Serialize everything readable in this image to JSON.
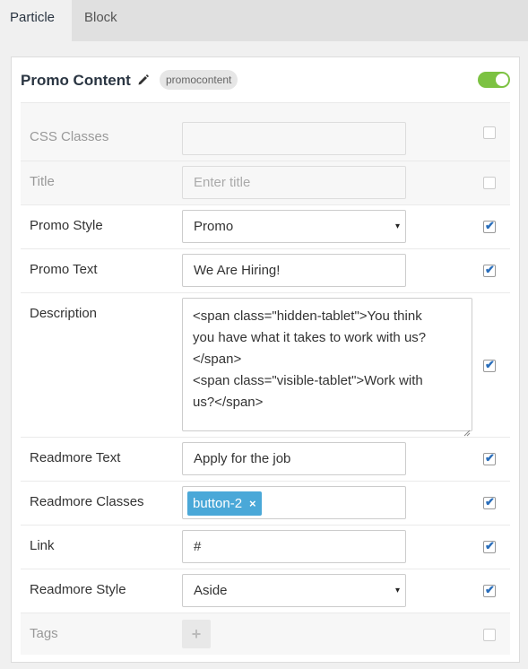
{
  "tabs": [
    {
      "label": "Particle",
      "active": true
    },
    {
      "label": "Block",
      "active": false
    }
  ],
  "card": {
    "title": "Promo Content",
    "badge": "promocontent",
    "enabled": true
  },
  "rows": {
    "css_classes": {
      "label": "CSS Classes",
      "value": "",
      "checked": false
    },
    "title": {
      "label": "Title",
      "placeholder": "Enter title",
      "checked": false
    },
    "promo_style": {
      "label": "Promo Style",
      "value": "Promo",
      "checked": true
    },
    "promo_text": {
      "label": "Promo Text",
      "value": "We Are Hiring!",
      "checked": true
    },
    "description": {
      "label": "Description",
      "lines": [
        "<span class=\"hidden-tablet\">You think",
        "you have what it takes to work with us?",
        "</span>",
        "<span class=\"visible-tablet\">Work with",
        "us?</span>"
      ],
      "checked": true
    },
    "readmore_text": {
      "label": "Readmore Text",
      "value": "Apply for the job",
      "checked": true
    },
    "readmore_classes": {
      "label": "Readmore Classes",
      "tag": "button-2",
      "tag_remove": "×",
      "checked": true
    },
    "link": {
      "label": "Link",
      "value": "#",
      "checked": true
    },
    "readmore_style": {
      "label": "Readmore Style",
      "value": "Aside",
      "checked": true
    },
    "tags": {
      "label": "Tags",
      "add_label": "+",
      "checked": false
    }
  },
  "icons": {
    "select_caret": "▾",
    "check": "✔"
  },
  "colors": {
    "toggle_on": "#7cc242",
    "tag_bg": "#4aa8d8",
    "check": "#2a6ebb"
  }
}
